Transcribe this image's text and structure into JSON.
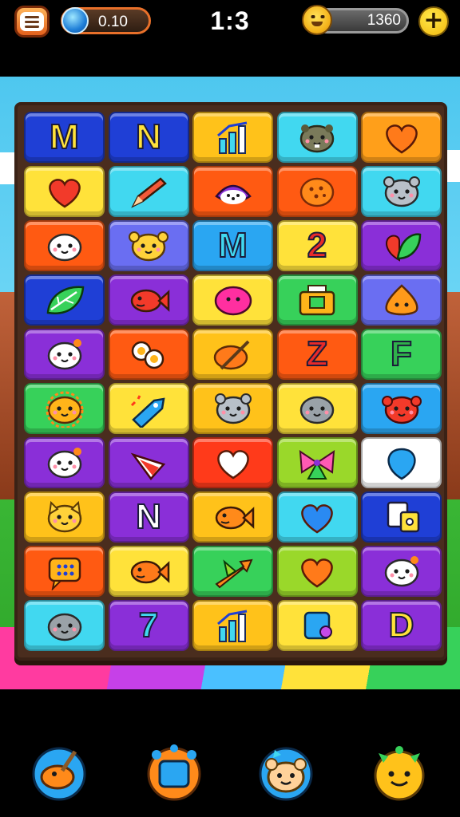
{
  "top_bar": {
    "gem_count": "0.10",
    "level": "1:3",
    "coin_count": "1360",
    "plus_label": "+"
  },
  "board": {
    "columns": 5,
    "tiles": [
      {
        "kind": "letter",
        "text": "M",
        "bg": "#1f3fd6",
        "fg": "#ffe23a"
      },
      {
        "kind": "letter",
        "text": "N",
        "bg": "#1f3fd6",
        "fg": "#ffe23a"
      },
      {
        "kind": "icon",
        "icon": "bar-chart-icon",
        "bg": "#ffc21a"
      },
      {
        "kind": "icon",
        "icon": "hamster-face-icon",
        "bg": "#41d8f0"
      },
      {
        "kind": "icon",
        "icon": "heart-icon",
        "bg": "#ff9f1a",
        "color": "#ff7a1a"
      },
      {
        "kind": "icon",
        "icon": "heart-icon",
        "bg": "#ffe23a",
        "color": "#f23a2a"
      },
      {
        "kind": "icon",
        "icon": "pencil-icon",
        "bg": "#41d8f0"
      },
      {
        "kind": "icon",
        "icon": "cat-face-icon",
        "bg": "#ff5a12"
      },
      {
        "kind": "icon",
        "icon": "cookie-icon",
        "bg": "#ff5a12"
      },
      {
        "kind": "icon",
        "icon": "mouse-face-icon",
        "bg": "#41d8f0"
      },
      {
        "kind": "icon",
        "icon": "seal-face-icon",
        "bg": "#ff5a12"
      },
      {
        "kind": "icon",
        "icon": "bear-face-icon",
        "bg": "#6a6ef2"
      },
      {
        "kind": "letter",
        "text": "M",
        "bg": "#2aa6f2",
        "fg": "#41d8f0"
      },
      {
        "kind": "letter",
        "text": "2",
        "bg": "#ffe23a",
        "fg": "#e82a2a"
      },
      {
        "kind": "icon",
        "icon": "leaf-heart-icon",
        "bg": "#8a2fd8"
      },
      {
        "kind": "icon",
        "icon": "leaf-icon",
        "bg": "#1f3fd6"
      },
      {
        "kind": "icon",
        "icon": "fish-icon",
        "bg": "#8a2fd8",
        "color": "#f23a2a"
      },
      {
        "kind": "icon",
        "icon": "blob-icon",
        "bg": "#ffe23a",
        "color": "#ff2fa0"
      },
      {
        "kind": "icon",
        "icon": "radio-icon",
        "bg": "#37d15a"
      },
      {
        "kind": "icon",
        "icon": "drop-face-icon",
        "bg": "#6a6ef2"
      },
      {
        "kind": "icon",
        "icon": "ghost-face-icon",
        "bg": "#8a2fd8"
      },
      {
        "kind": "icon",
        "icon": "eggs-icon",
        "bg": "#ff5a12"
      },
      {
        "kind": "icon",
        "icon": "paintbrush-icon",
        "bg": "#ffc21a"
      },
      {
        "kind": "letter",
        "text": "Z",
        "bg": "#ff5a12",
        "fg": "#e82a2a"
      },
      {
        "kind": "letter",
        "text": "F",
        "bg": "#37d15a",
        "fg": "#2fb04a"
      },
      {
        "kind": "icon",
        "icon": "lion-face-icon",
        "bg": "#37d15a"
      },
      {
        "kind": "icon",
        "icon": "rocket-icon",
        "bg": "#ffe23a"
      },
      {
        "kind": "icon",
        "icon": "mouse-face-icon",
        "bg": "#ffc21a"
      },
      {
        "kind": "icon",
        "icon": "seal-gray-icon",
        "bg": "#ffe23a"
      },
      {
        "kind": "icon",
        "icon": "crab-face-icon",
        "bg": "#2aa6f2"
      },
      {
        "kind": "icon",
        "icon": "ghost-face-icon",
        "bg": "#8a2fd8"
      },
      {
        "kind": "icon",
        "icon": "candy-icon",
        "bg": "#8a2fd8"
      },
      {
        "kind": "icon",
        "icon": "heart-icon",
        "bg": "#ff3a1a",
        "color": "#ffffff"
      },
      {
        "kind": "icon",
        "icon": "bow-icon",
        "bg": "#9ad82a"
      },
      {
        "kind": "icon",
        "icon": "balloon-icon",
        "bg": "#ffffff"
      },
      {
        "kind": "icon",
        "icon": "cat-face-yellow-icon",
        "bg": "#ffc21a"
      },
      {
        "kind": "letter",
        "text": "N",
        "bg": "#8a2fd8",
        "fg": "#ffffff"
      },
      {
        "kind": "icon",
        "icon": "fish-icon",
        "bg": "#ffc21a",
        "color": "#ff8a1a"
      },
      {
        "kind": "icon",
        "icon": "heart-icon",
        "bg": "#41d8f0",
        "color": "#2a8af2"
      },
      {
        "kind": "icon",
        "icon": "dice-icon",
        "bg": "#1f3fd6"
      },
      {
        "kind": "icon",
        "icon": "chat-bubble-icon",
        "bg": "#ff5a12"
      },
      {
        "kind": "icon",
        "icon": "fish-icon",
        "bg": "#ffe23a",
        "color": "#ff7a1a"
      },
      {
        "kind": "icon",
        "icon": "arrow-icon",
        "bg": "#37d15a"
      },
      {
        "kind": "icon",
        "icon": "heart-icon",
        "bg": "#9ad82a",
        "color": "#ff7a1a"
      },
      {
        "kind": "icon",
        "icon": "ghost-face-icon",
        "bg": "#8a2fd8"
      },
      {
        "kind": "icon",
        "icon": "seal-gray-icon",
        "bg": "#41d8f0"
      },
      {
        "kind": "letter",
        "text": "7",
        "bg": "#8a2fd8",
        "fg": "#41d8f0"
      },
      {
        "kind": "icon",
        "icon": "bar-chart-icon",
        "bg": "#ffc21a"
      },
      {
        "kind": "icon",
        "icon": "square-icon",
        "bg": "#ffe23a"
      },
      {
        "kind": "letter",
        "text": "D",
        "bg": "#8a2fd8",
        "fg": "#ffe23a"
      }
    ]
  },
  "bottom_bar": [
    {
      "name": "paint-button",
      "icon": "paint-icon"
    },
    {
      "name": "shape-button",
      "icon": "blue-square-icon"
    },
    {
      "name": "bear-button",
      "icon": "bear-icon"
    },
    {
      "name": "smiley-button",
      "icon": "smiley-icon"
    }
  ]
}
